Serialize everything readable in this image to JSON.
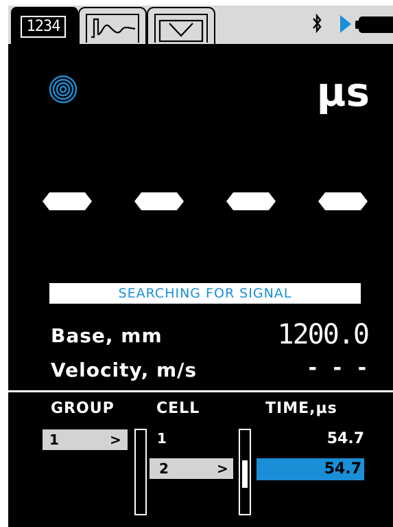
{
  "tabs": [
    {
      "label": "1234",
      "icon": "digits-icon",
      "active": true
    },
    {
      "label": "",
      "icon": "waveform-icon",
      "active": false
    },
    {
      "label": "",
      "icon": "pulse-icon",
      "active": false
    }
  ],
  "status_bar": {
    "bluetooth_icon": "bluetooth-icon",
    "play_icon": "play-icon",
    "battery_icon": "battery-icon"
  },
  "colors": {
    "accent": "#1a8fd8",
    "background": "#000000",
    "tabbar": "#d9d9d9"
  },
  "main": {
    "sensor_icon": "signal-rings-icon",
    "unit": "µs",
    "reading_placeholder": [
      "—",
      "—",
      "—",
      "—"
    ],
    "status_text": "SEARCHING FOR SIGNAL",
    "base_label": "Base, mm",
    "base_value": "1200.0",
    "velocity_label": "Velocity, m/s",
    "velocity_value": "- - -"
  },
  "table": {
    "headers": {
      "group": "GROUP",
      "cell": "CELL",
      "time": "TIME,µs"
    },
    "group": {
      "value": "1",
      "arrow": ">"
    },
    "cells": [
      {
        "cell": "1",
        "time": "54.7",
        "selected": false
      },
      {
        "cell": "2",
        "arrow": ">",
        "time": "54.7",
        "selected": true
      }
    ]
  }
}
